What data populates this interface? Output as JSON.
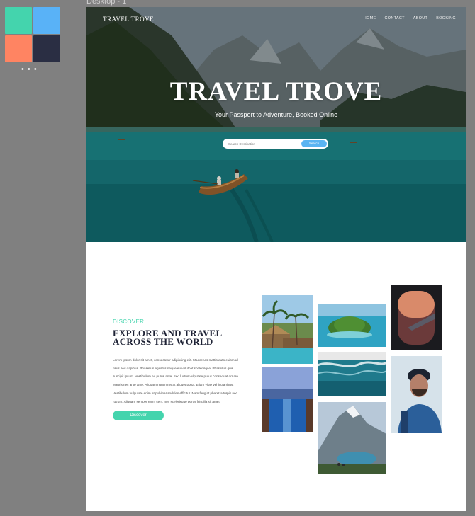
{
  "frame_label": "Desktop - 1",
  "swatches": [
    {
      "name": "mint",
      "color": "#44d4ad"
    },
    {
      "name": "sky-blue",
      "color": "#59b2f7"
    },
    {
      "name": "coral",
      "color": "#ff8462"
    },
    {
      "name": "navy",
      "color": "#2a2e43"
    }
  ],
  "swatch_dots": "• • •",
  "header": {
    "logo": "TRAVEL TROVE",
    "nav": [
      "HOME",
      "CONTACT",
      "ABOUT",
      "BOOKING"
    ]
  },
  "hero": {
    "title": "TRAVEL TROVE",
    "subtitle": "Your Passport to Adventure, Booked Online",
    "search_placeholder": "Search Destination",
    "search_button": "Search"
  },
  "discover": {
    "eyebrow": "DISCOVER",
    "title_line1": "EXPLORE AND TRAVEL",
    "title_line2": "ACROSS THE WORLD",
    "body": "Lorem ipsum dolor sit amet, consectetur adipiscing elit. Maecenas mattis auto euismod risus sed dapibus. Phasellus egestas neque eu volutpat scelerisque. Phasellus quis suscipit ipsum. Vestibulum eu purus ante. Sed luctus vulputate purus consequat ornare. Mauris nec ante ante. Aliquam nonummy at aliquet porta. Etiam vitae vehicula risus. Vestibulum vulputate enim et pulvinar sodales efficitur. Nam feugiat pharetra turpis nec rutrum. Aliquam semper enim sem, non scelerisque purus fringilla sit amet.",
    "button": "Discover"
  },
  "accent_color": "#44d4ad",
  "button_blue": "#5ab4f2"
}
